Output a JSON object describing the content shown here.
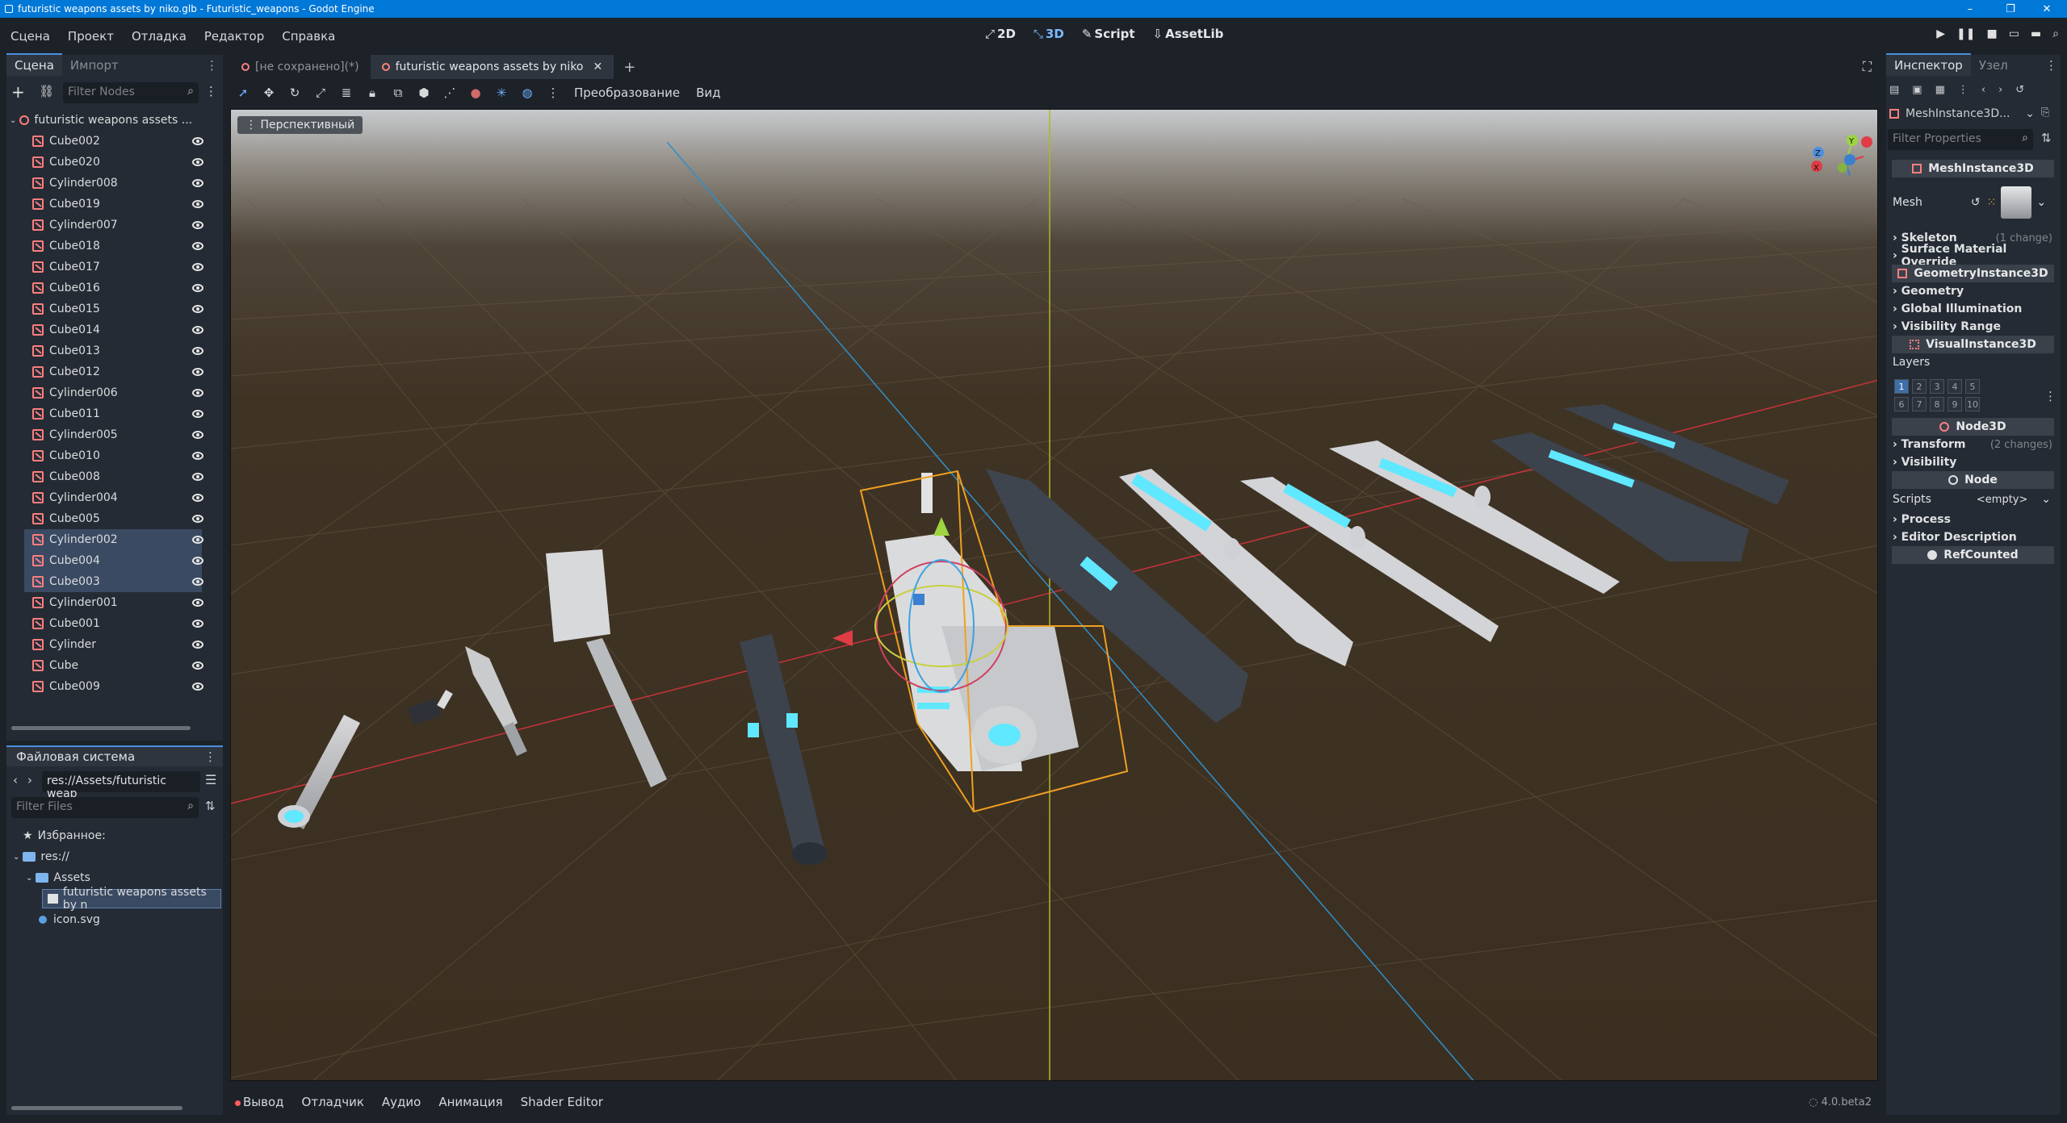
{
  "window": {
    "title": "futuristic weapons assets by niko.glb - Futuristic_weapons - Godot Engine",
    "controls": [
      "–",
      "❐",
      "✕"
    ]
  },
  "menu": [
    "Сцена",
    "Проект",
    "Отладка",
    "Редактор",
    "Справка"
  ],
  "main_screens": [
    {
      "icon": "2D",
      "label": "2D"
    },
    {
      "icon": "3D",
      "label": "3D"
    },
    {
      "icon": "script",
      "label": "Script"
    },
    {
      "icon": "assetlib",
      "label": "AssetLib"
    }
  ],
  "run_buttons": [
    "play-icon",
    "pause-icon",
    "stop-icon",
    "play-scene-icon",
    "play-custom-icon",
    "movie-icon"
  ],
  "scene_dock": {
    "tabs": [
      "Сцена",
      "Импорт"
    ],
    "filter_placeholder": "Filter Nodes",
    "root": "futuristic weapons assets ...",
    "nodes": [
      "Cube002",
      "Cube020",
      "Cylinder008",
      "Cube019",
      "Cylinder007",
      "Cube018",
      "Cube017",
      "Cube016",
      "Cube015",
      "Cube014",
      "Cube013",
      "Cube012",
      "Cylinder006",
      "Cube011",
      "Cylinder005",
      "Cube010",
      "Cube008",
      "Cylinder004",
      "Cube005",
      "Cylinder002",
      "Cube004",
      "Cube003",
      "Cylinder001",
      "Cube001",
      "Cylinder",
      "Cube",
      "Cube009"
    ],
    "selected": [
      "Cylinder002",
      "Cube004",
      "Cube003"
    ]
  },
  "filesystem_dock": {
    "title": "Файловая система",
    "path": "res://Assets/futuristic weap",
    "filter_placeholder": "Filter Files",
    "items": [
      {
        "label": "Избранное:",
        "type": "favorites"
      },
      {
        "label": "res://",
        "type": "folder"
      },
      {
        "label": "Assets",
        "type": "folder"
      },
      {
        "label": "futuristic weapons assets by n",
        "type": "file"
      },
      {
        "label": "icon.svg",
        "type": "file"
      }
    ]
  },
  "doc_tabs": [
    {
      "label": "[не сохранено](*)",
      "selected": false
    },
    {
      "label": "futuristic weapons assets by niko",
      "selected": true
    }
  ],
  "toolbar3d": {
    "transform_label": "Преобразование",
    "view_label": "Вид"
  },
  "viewport": {
    "view_mode": "Перспективный",
    "gizmo_axes": [
      "Y",
      "X",
      "Z"
    ]
  },
  "bottom_panel": {
    "tabs": [
      "Вывод",
      "Отладчик",
      "Аудио",
      "Анимация",
      "Shader Editor"
    ],
    "version": "4.0.beta2"
  },
  "inspector": {
    "tabs": [
      "Инспектор",
      "Узел"
    ],
    "object": "MeshInstance3D...",
    "filter_placeholder": "Filter Properties",
    "sections": [
      {
        "kind": "class",
        "label": "MeshInstance3D"
      },
      {
        "kind": "prop",
        "label": "Mesh"
      },
      {
        "kind": "group",
        "label": "Skeleton",
        "note": "(1 change)"
      },
      {
        "kind": "group",
        "label": "Surface Material Override",
        "note": ""
      },
      {
        "kind": "class",
        "label": "GeometryInstance3D"
      },
      {
        "kind": "group",
        "label": "Geometry",
        "note": ""
      },
      {
        "kind": "group",
        "label": "Global Illumination",
        "note": ""
      },
      {
        "kind": "group",
        "label": "Visibility Range",
        "note": ""
      },
      {
        "kind": "class",
        "label": "VisualInstance3D"
      },
      {
        "kind": "prop",
        "label": "Layers"
      },
      {
        "kind": "class",
        "label": "Node3D"
      },
      {
        "kind": "group",
        "label": "Transform",
        "note": "(2 changes)"
      },
      {
        "kind": "group",
        "label": "Visibility",
        "note": ""
      },
      {
        "kind": "class",
        "label": "Node"
      },
      {
        "kind": "prop",
        "label": "Scripts",
        "value": "<empty>"
      },
      {
        "kind": "group",
        "label": "Process",
        "note": ""
      },
      {
        "kind": "group",
        "label": "Editor Description",
        "note": ""
      },
      {
        "kind": "class",
        "label": "RefCounted"
      }
    ],
    "layers_row1": [
      "1",
      "2",
      "3",
      "4",
      "5"
    ],
    "layers_row2": [
      "6",
      "7",
      "8",
      "9",
      "10"
    ]
  }
}
